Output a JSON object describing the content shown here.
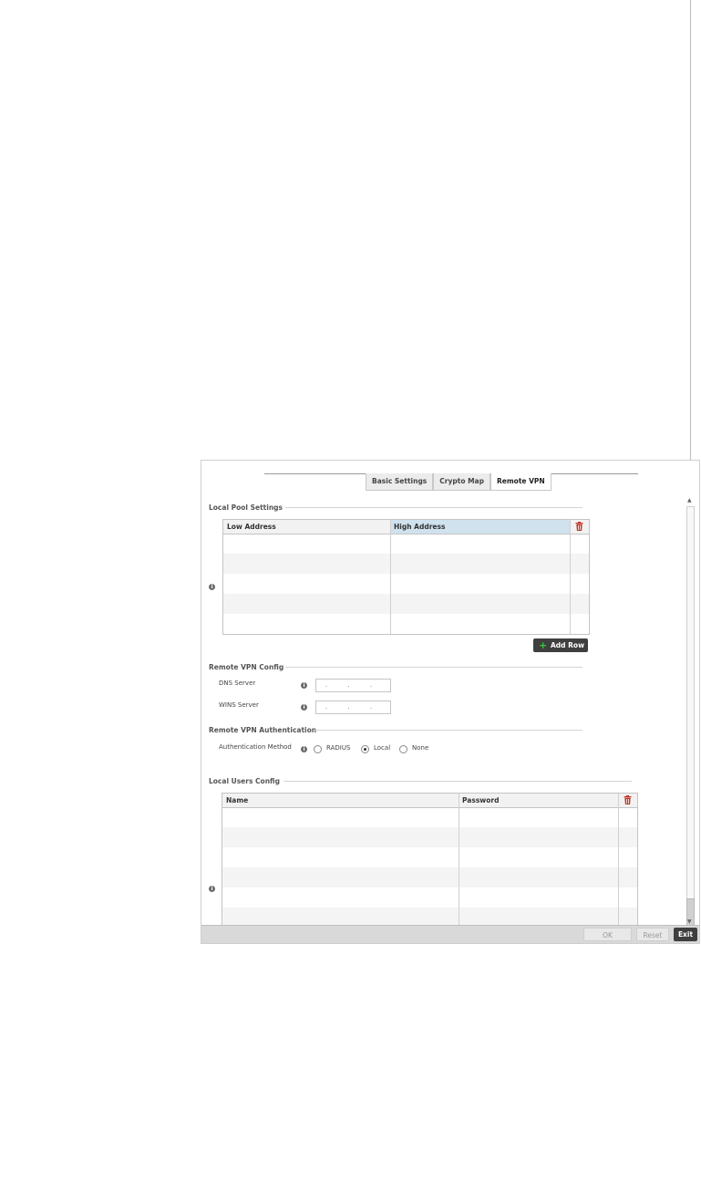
{
  "tabs": [
    {
      "label": "Basic Settings"
    },
    {
      "label": "Crypto Map"
    },
    {
      "label": "Remote VPN"
    }
  ],
  "local_pool": {
    "title": "Local Pool Settings",
    "columns": [
      "Low Address",
      "High Address"
    ],
    "add_row_label": "Add Row"
  },
  "remote_vpn_config": {
    "title": "Remote VPN Config",
    "dns_label": "DNS Server",
    "wins_label": "WINS Server",
    "dns_value": ". . .",
    "wins_value": ". . ."
  },
  "remote_vpn_auth": {
    "title": "Remote VPN Authentication",
    "method_label": "Authentication Method",
    "options": [
      "RADIUS",
      "Local",
      "None"
    ],
    "selected": "Local"
  },
  "local_users": {
    "title": "Local Users Config",
    "columns": [
      "Name",
      "Password"
    ]
  },
  "footer": {
    "ok": "OK",
    "reset": "Reset",
    "exit": "Exit"
  },
  "colors": {
    "selected_header": "#cfe2ee",
    "delete_icon": "#c0392b",
    "add_icon": "#35c43a"
  }
}
